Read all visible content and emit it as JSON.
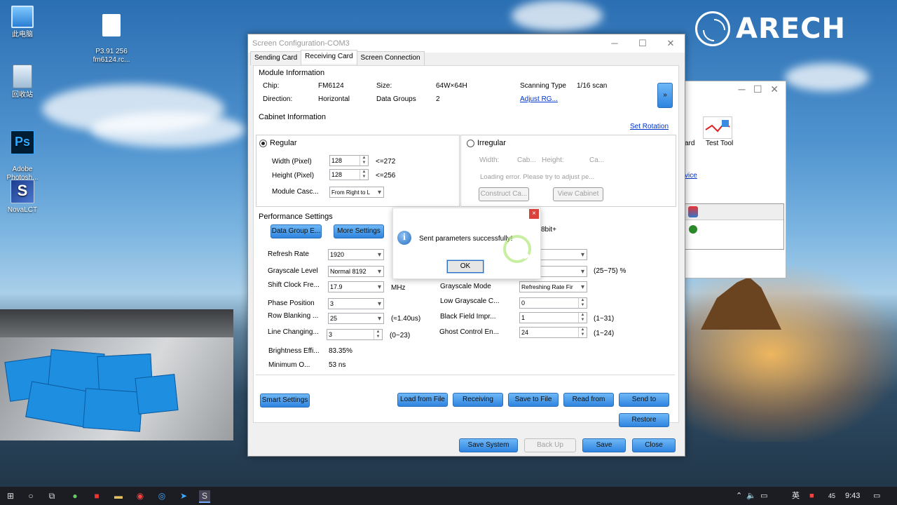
{
  "desktop": {
    "icons": [
      {
        "label": "此电脑",
        "glyph": "computer-icon"
      },
      {
        "label": "P3.91 256\nfm6124.rc...",
        "glyph": "file-icon"
      },
      {
        "label": "回收站",
        "glyph": "recycle-bin-icon"
      },
      {
        "label": "Adobe\nPhotosh...",
        "glyph": "photoshop-icon",
        "badge": "Ps"
      },
      {
        "label": "NovaLCT",
        "glyph": "novalct-icon"
      }
    ],
    "logo_text": "ARECH"
  },
  "background_window": {
    "toolbar_partial": "ard",
    "test_tool_label": "Test Tool",
    "link_partial": "vice"
  },
  "window": {
    "title": "Screen Configuration-COM3",
    "tabs": [
      {
        "label": "Sending Card",
        "active": false
      },
      {
        "label": "Receiving Card",
        "active": true
      },
      {
        "label": "Screen Connection",
        "active": false
      }
    ],
    "module_info": {
      "heading": "Module Information",
      "chip_label": "Chip:",
      "chip_value": "FM6124",
      "size_label": "Size:",
      "size_value": "64W×64H",
      "scan_label": "Scanning Type",
      "scan_value": "1/16 scan",
      "direction_label": "Direction:",
      "direction_value": "Horizontal",
      "datagroups_label": "Data Groups",
      "datagroups_value": "2",
      "adjust_link": "Adjust RG...",
      "expand_button": "»"
    },
    "cabinet_info": {
      "heading": "Cabinet Information",
      "set_rotation": "Set Rotation",
      "regular": {
        "label": "Regular",
        "width_label": "Width (Pixel)",
        "width_value": "128",
        "width_limit": "<=272",
        "height_label": "Height (Pixel)",
        "height_value": "128",
        "height_limit": "<=256",
        "cascade_label": "Module Casc...",
        "cascade_value": "From Right to L"
      },
      "irregular": {
        "label": "Irregular",
        "width_label": "Width:",
        "width_value": "Cab...",
        "height_label": "Height:",
        "height_value": "Ca...",
        "error_text": "Loading error. Please try to adjust pe...",
        "construct_button": "Construct Ca...",
        "view_button": "View Cabinet"
      }
    },
    "performance": {
      "heading": "Performance Settings",
      "data_group_button": "Data Group E...",
      "more_settings_button": "More Settings",
      "bit_label": "8bit+",
      "left": [
        {
          "label": "Refresh Rate",
          "value": "1920",
          "kind": "select"
        },
        {
          "label": "Grayscale Level",
          "value": "Normal 8192",
          "kind": "select"
        },
        {
          "label": "Shift Clock Fre...",
          "value": "17.9",
          "kind": "select",
          "unit": "MHz"
        },
        {
          "label": "Phase Position",
          "value": "3",
          "kind": "select"
        },
        {
          "label": "Row Blanking ...",
          "value": "25",
          "kind": "select",
          "unit": "(≈1.40us)"
        },
        {
          "label": "Line Changing...",
          "value": "3",
          "kind": "spin",
          "unit": "(0~23)"
        },
        {
          "label": "Brightness Effi...",
          "value": "83.35%",
          "kind": "text"
        },
        {
          "label": "Minimum O...",
          "value": "53 ns",
          "kind": "text"
        }
      ],
      "right": [
        {
          "label": "",
          "value": "",
          "kind": "select"
        },
        {
          "label": "",
          "value": "",
          "kind": "select",
          "unit": "(25~75) %"
        },
        {
          "label": "Grayscale Mode",
          "value": "Refreshing Rate Fir",
          "kind": "select"
        },
        {
          "label": "Low Grayscale C...",
          "value": "0",
          "kind": "spin"
        },
        {
          "label": "Black Field Impr...",
          "value": "1",
          "kind": "spin",
          "unit": "(1~31)"
        },
        {
          "label": "Ghost Control En...",
          "value": "24",
          "kind": "spin",
          "unit": "(1~24)"
        }
      ]
    },
    "buttons": {
      "smart_settings": "Smart Settings",
      "load_from_file": "Load from File",
      "receiving_card": "Receiving Car...",
      "save_to_file": "Save to File",
      "read_from": "Read from Re...",
      "send_to": "Send to Recei...",
      "restore": "Restore Facto...",
      "save_system": "Save System Co...",
      "back_up": "Back Up Termi...",
      "save": "Save",
      "close": "Close"
    }
  },
  "dialog": {
    "message": "Sent parameters successfully!",
    "ok": "OK",
    "close": "×"
  },
  "taskbar": {
    "time": "9:43",
    "ime": "英",
    "tray_extra": "45"
  }
}
